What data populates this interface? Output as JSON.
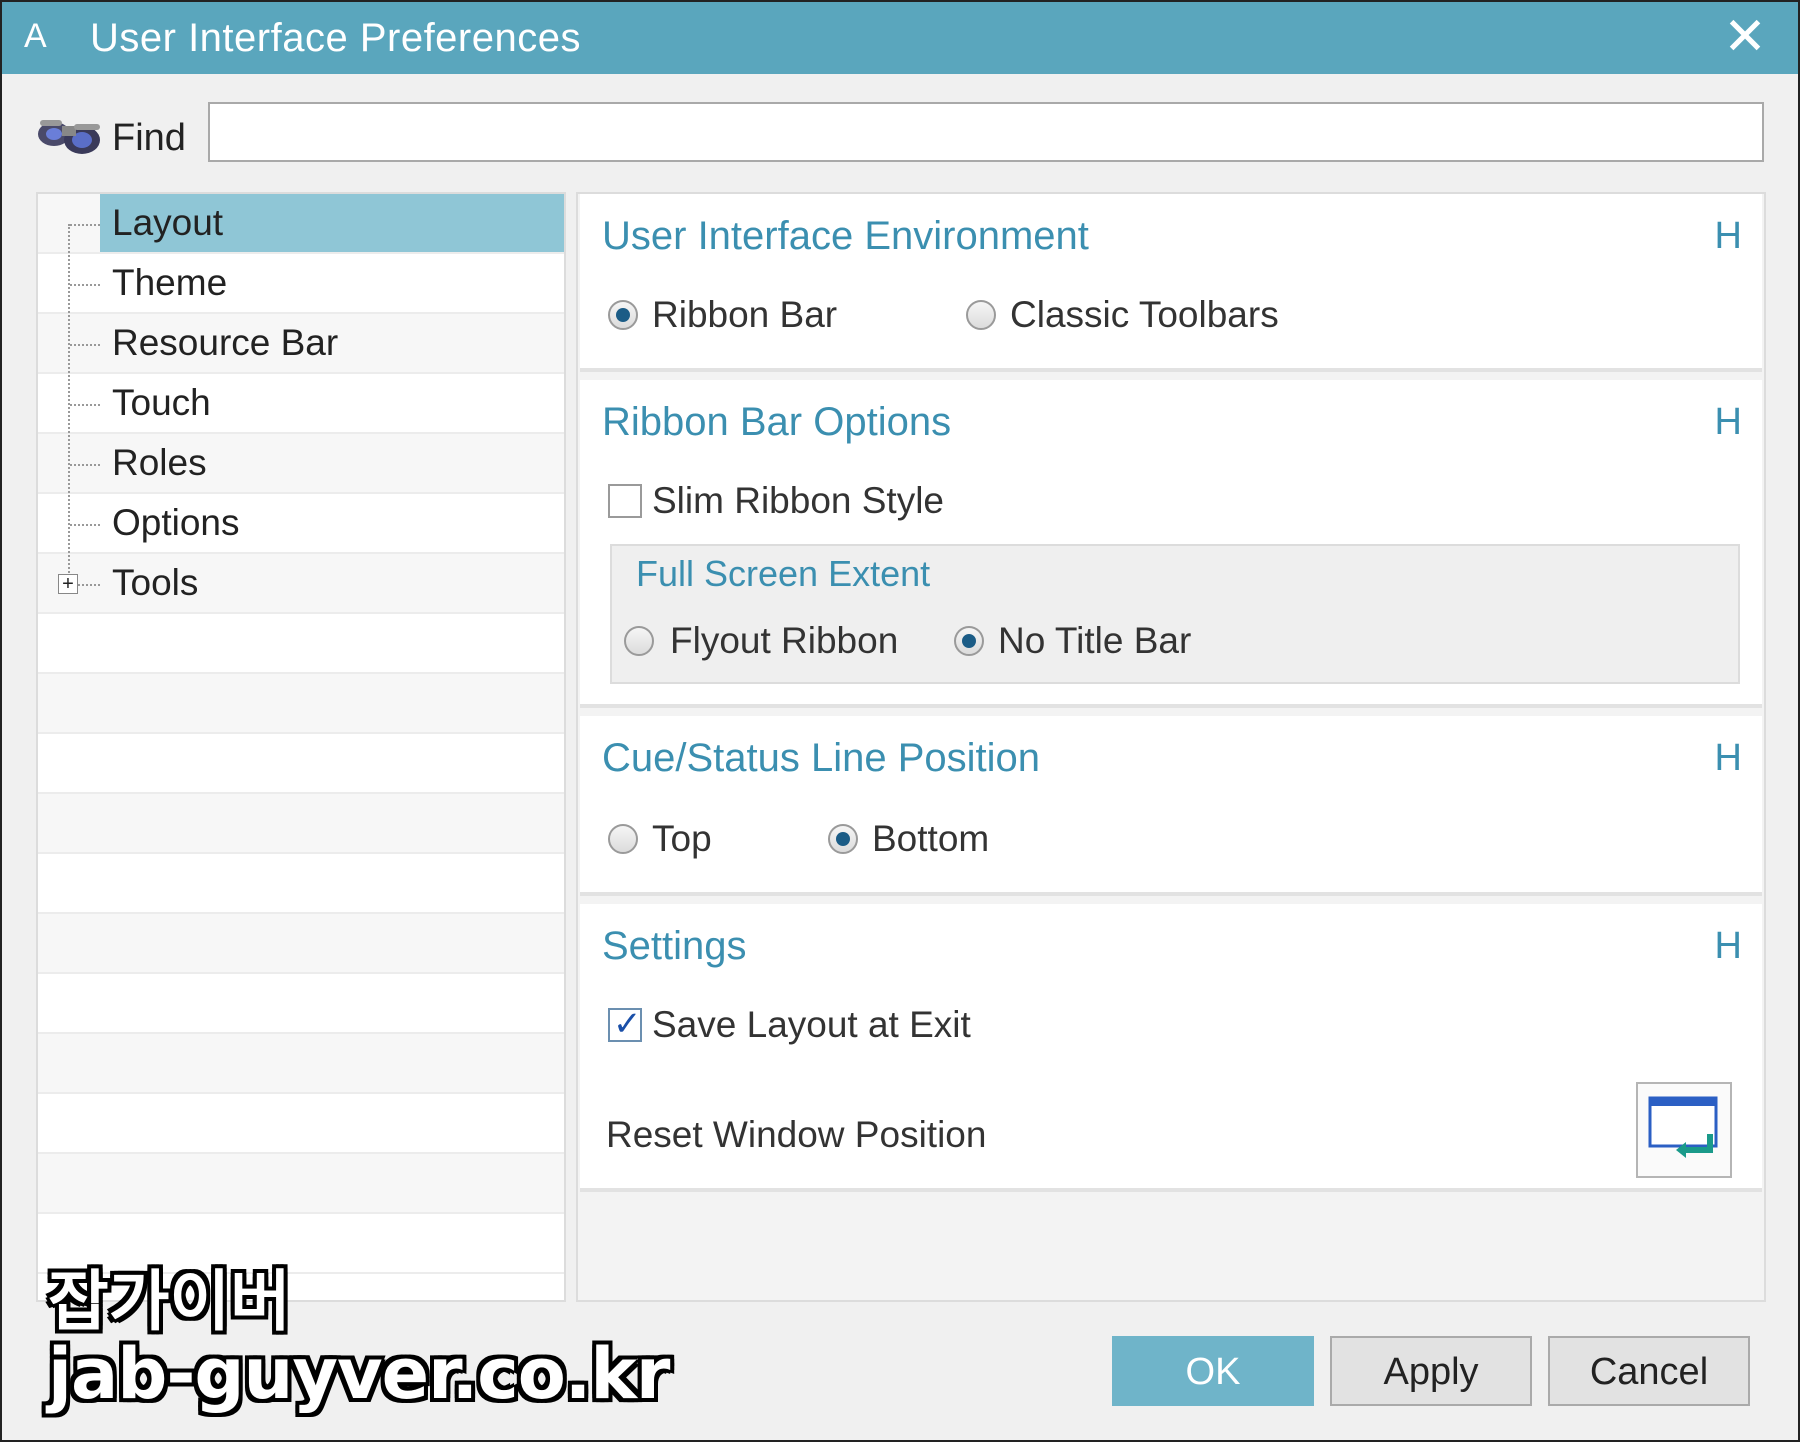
{
  "window": {
    "title": "User Interface Preferences",
    "close_glyph": "✕",
    "app_glyph": "A"
  },
  "find": {
    "label": "Find",
    "value": ""
  },
  "tree": {
    "items": [
      {
        "label": "Layout",
        "selected": true
      },
      {
        "label": "Theme"
      },
      {
        "label": "Resource Bar"
      },
      {
        "label": "Touch"
      },
      {
        "label": "Roles"
      },
      {
        "label": "Options"
      },
      {
        "label": "Tools",
        "expandable": true
      }
    ],
    "expand_glyph": "+"
  },
  "groups": {
    "ui_env": {
      "title": "User Interface Environment",
      "h": "H",
      "options": [
        "Ribbon Bar",
        "Classic Toolbars"
      ],
      "selected": "Ribbon Bar"
    },
    "ribbon": {
      "title": "Ribbon Bar Options",
      "h": "H",
      "slim_label": "Slim Ribbon Style",
      "slim_checked": false,
      "fullscreen_title": "Full Screen Extent",
      "fullscreen_options": [
        "Flyout Ribbon",
        "No Title Bar"
      ],
      "fullscreen_selected": "No Title Bar"
    },
    "cue": {
      "title": "Cue/Status Line Position",
      "h": "H",
      "options": [
        "Top",
        "Bottom"
      ],
      "selected": "Bottom"
    },
    "settings": {
      "title": "Settings",
      "h": "H",
      "save_label": "Save Layout at Exit",
      "save_checked": true,
      "reset_label": "Reset Window Position",
      "reset_icon": "reset-window-icon"
    }
  },
  "buttons": {
    "ok": "OK",
    "apply": "Apply",
    "cancel": "Cancel"
  },
  "watermark": {
    "line1": "잡가이버",
    "line2": "jab-guyver.co.kr"
  },
  "colors": {
    "titlebar": "#5aa6bd",
    "accent": "#3b8fb0",
    "selection": "#8fc6d6",
    "ok_button": "#6fb4c9"
  }
}
